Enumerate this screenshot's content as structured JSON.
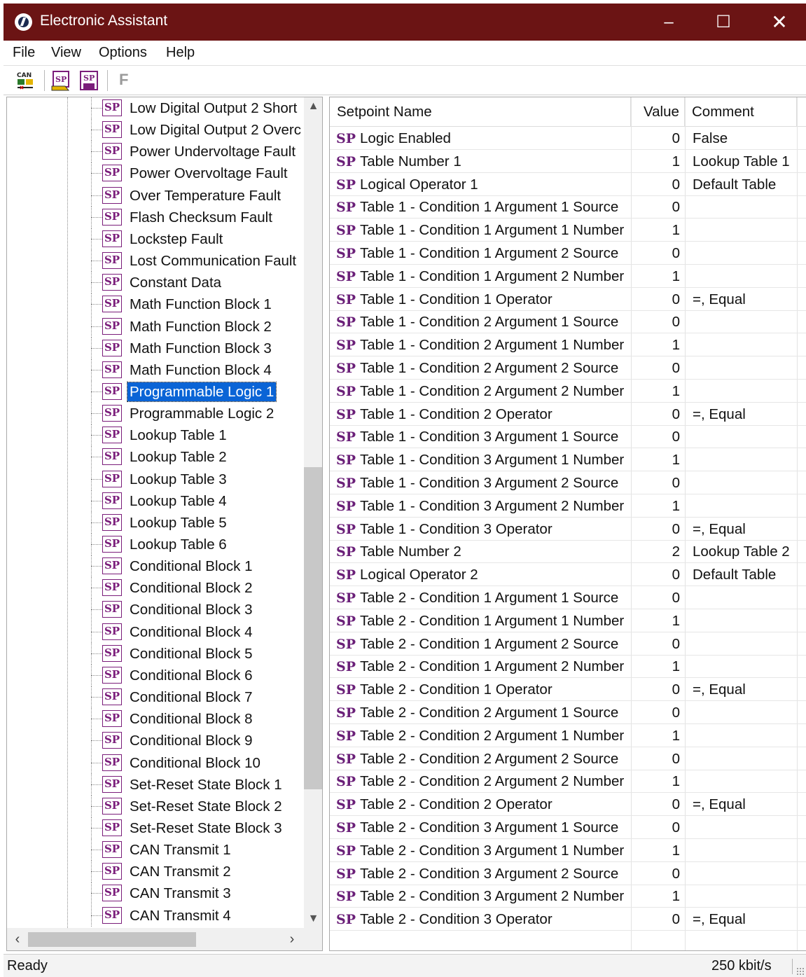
{
  "window": {
    "title": "Electronic Assistant",
    "minimize_label": "–",
    "maximize_label": "☐",
    "close_label": "✕"
  },
  "menu": [
    "File",
    "View",
    "Options",
    "Help"
  ],
  "toolbar": {
    "buttons": [
      "can-connect-icon",
      "sp-read-icon",
      "sp-write-icon"
    ],
    "flash_label": "F"
  },
  "tree": {
    "selected": "Programmable Logic 1",
    "icon_text": "SP",
    "items": [
      "Low Digital Output 2 Short",
      "Low Digital Output 2 Overc",
      "Power Undervoltage Fault",
      "Power Overvoltage Fault",
      "Over Temperature Fault",
      "Flash Checksum Fault",
      "Lockstep Fault",
      "Lost Communication Fault",
      "Constant Data",
      "Math Function Block 1",
      "Math Function Block 2",
      "Math Function Block 3",
      "Math Function Block 4",
      "Programmable Logic 1",
      "Programmable Logic 2",
      "Lookup Table 1",
      "Lookup Table 2",
      "Lookup Table 3",
      "Lookup Table 4",
      "Lookup Table 5",
      "Lookup Table 6",
      "Conditional Block 1",
      "Conditional Block 2",
      "Conditional Block 3",
      "Conditional Block 4",
      "Conditional Block 5",
      "Conditional Block 6",
      "Conditional Block 7",
      "Conditional Block 8",
      "Conditional Block 9",
      "Conditional Block 10",
      "Set-Reset State Block 1",
      "Set-Reset State Block 2",
      "Set-Reset State Block 3",
      "CAN Transmit 1",
      "CAN Transmit 2",
      "CAN Transmit 3",
      "CAN Transmit 4"
    ]
  },
  "grid": {
    "headers": {
      "name": "Setpoint Name",
      "value": "Value",
      "comment": "Comment"
    },
    "row_prefix": "SP",
    "rows": [
      {
        "name": "Logic Enabled",
        "value": "0",
        "comment": "False"
      },
      {
        "name": "Table Number 1",
        "value": "1",
        "comment": "Lookup Table 1"
      },
      {
        "name": "Logical Operator 1",
        "value": "0",
        "comment": "Default Table"
      },
      {
        "name": "Table 1 - Condition 1 Argument 1 Source",
        "value": "0",
        "comment": ""
      },
      {
        "name": "Table 1 - Condition 1 Argument 1 Number",
        "value": "1",
        "comment": ""
      },
      {
        "name": "Table 1 - Condition 1 Argument 2 Source",
        "value": "0",
        "comment": ""
      },
      {
        "name": "Table 1 - Condition 1 Argument 2 Number",
        "value": "1",
        "comment": ""
      },
      {
        "name": "Table 1 - Condition 1 Operator",
        "value": "0",
        "comment": "=, Equal"
      },
      {
        "name": "Table 1 - Condition 2 Argument 1 Source",
        "value": "0",
        "comment": ""
      },
      {
        "name": "Table 1 - Condition 2 Argument 1 Number",
        "value": "1",
        "comment": ""
      },
      {
        "name": "Table 1 - Condition 2 Argument 2 Source",
        "value": "0",
        "comment": ""
      },
      {
        "name": "Table 1 - Condition 2 Argument 2 Number",
        "value": "1",
        "comment": ""
      },
      {
        "name": "Table 1 - Condition 2 Operator",
        "value": "0",
        "comment": "=, Equal"
      },
      {
        "name": "Table 1 - Condition 3 Argument 1 Source",
        "value": "0",
        "comment": ""
      },
      {
        "name": "Table 1 - Condition 3 Argument 1 Number",
        "value": "1",
        "comment": ""
      },
      {
        "name": "Table 1 - Condition 3 Argument 2 Source",
        "value": "0",
        "comment": ""
      },
      {
        "name": "Table 1 - Condition 3 Argument 2 Number",
        "value": "1",
        "comment": ""
      },
      {
        "name": "Table 1 - Condition 3 Operator",
        "value": "0",
        "comment": "=, Equal"
      },
      {
        "name": "Table Number 2",
        "value": "2",
        "comment": "Lookup Table 2"
      },
      {
        "name": "Logical Operator 2",
        "value": "0",
        "comment": "Default Table"
      },
      {
        "name": "Table 2 - Condition 1 Argument 1 Source",
        "value": "0",
        "comment": ""
      },
      {
        "name": "Table 2 - Condition 1 Argument 1 Number",
        "value": "1",
        "comment": ""
      },
      {
        "name": "Table 2 - Condition 1 Argument 2 Source",
        "value": "0",
        "comment": ""
      },
      {
        "name": "Table 2 - Condition 1 Argument 2 Number",
        "value": "1",
        "comment": ""
      },
      {
        "name": "Table 2 - Condition 1 Operator",
        "value": "0",
        "comment": "=, Equal"
      },
      {
        "name": "Table 2 - Condition 2 Argument 1 Source",
        "value": "0",
        "comment": ""
      },
      {
        "name": "Table 2 - Condition 2 Argument 1 Number",
        "value": "1",
        "comment": ""
      },
      {
        "name": "Table 2 - Condition 2 Argument 2 Source",
        "value": "0",
        "comment": ""
      },
      {
        "name": "Table 2 - Condition 2 Argument 2 Number",
        "value": "1",
        "comment": ""
      },
      {
        "name": "Table 2 - Condition 2 Operator",
        "value": "0",
        "comment": "=, Equal"
      },
      {
        "name": "Table 2 - Condition 3 Argument 1 Source",
        "value": "0",
        "comment": ""
      },
      {
        "name": "Table 2 - Condition 3 Argument 1 Number",
        "value": "1",
        "comment": ""
      },
      {
        "name": "Table 2 - Condition 3 Argument 2 Source",
        "value": "0",
        "comment": ""
      },
      {
        "name": "Table 2 - Condition 3 Argument 2 Number",
        "value": "1",
        "comment": ""
      },
      {
        "name": "Table 2 - Condition 3 Operator",
        "value": "0",
        "comment": "=, Equal"
      }
    ]
  },
  "status": {
    "text": "Ready",
    "baud_rate": "250 kbit/s"
  },
  "colors": {
    "titlebar": "#6b1414",
    "selection": "#0a64d6",
    "sp_icon": "#7a1d7a"
  }
}
